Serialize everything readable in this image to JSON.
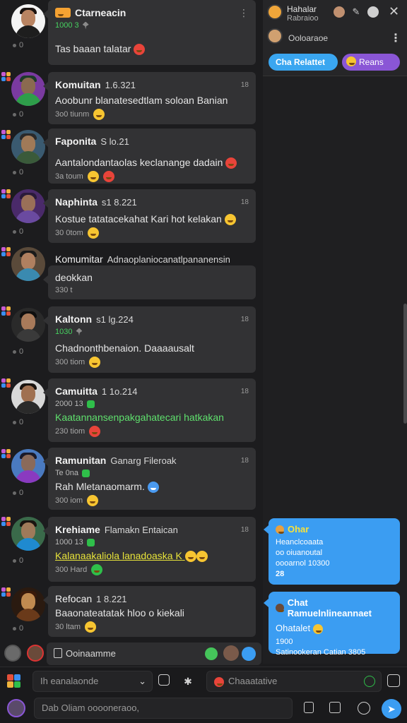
{
  "header": {
    "name": "Ctarneacin",
    "sub": "1000 3",
    "text": "Tas baaan talatar"
  },
  "messages": [
    {
      "name": "Komuitan",
      "time": "1.6.321",
      "right": "18",
      "text": "Aoobunr blanatesedtlam soloan Banian",
      "foot": "3o0 tiunm",
      "side": "0"
    },
    {
      "name": "Faponita",
      "time": "S lo.21",
      "right": "",
      "text": "Aantalondantaolas keclanange dadain",
      "foot": "3a toum",
      "side": "0"
    },
    {
      "name": "Naphinta",
      "time": "s1 8.221",
      "right": "18",
      "text": "Kostue tatatacekahat Kari hot kelakan",
      "foot": "30 0tom",
      "side": "0"
    },
    {
      "name": "Komumitar",
      "time": "Adnaoplaniocanatlpananensin",
      "right": "",
      "text": "deokkan",
      "foot": "330 t",
      "side": ""
    },
    {
      "name": "Kaltonn",
      "time": "s1 lg.224",
      "right": "18",
      "sub": "1030",
      "text": "Chadnonthbenaion. Daaaausalt",
      "foot": "300 tiom",
      "side": "0"
    },
    {
      "name": "Camuitta",
      "time": "1 1o.214",
      "right": "18",
      "sub": "2000 13",
      "text": "Kaatannansenpakgahatecari hatkakan",
      "foot": "230 tiom",
      "side": "0"
    },
    {
      "name": "Ramunitan",
      "time": "Ganarg Fileroak",
      "right": "18",
      "sub": "Te 0na",
      "text": "Rah Mletanaomarm.",
      "foot": "300 iom",
      "side": "0"
    },
    {
      "name": "Krehiame",
      "time": "Flamakn Entaican",
      "right": "18",
      "sub": "1000 13",
      "text": "Kalanaakaliola lanadoaska K",
      "foot": "300 Hard",
      "side": "0"
    },
    {
      "name": "Refocan",
      "time": "1 8.221",
      "right": "",
      "text": "Baaonateatatak hloo o kiekali",
      "foot": "30 ltam",
      "side": "0"
    }
  ],
  "quickbar": {
    "label": "Ooinaamme"
  },
  "right_panel": {
    "header_title": "Hahalar",
    "header_sub": "Rabraioo",
    "row2": "Ooloaraoe",
    "pill_blue": "Cha Relattet",
    "pill_purple": "Reans",
    "bubble1": {
      "title": "Ohar",
      "lines": [
        "Heanclcoaata",
        "oo oiuanoutal",
        "oooarnol 10300",
        "28"
      ]
    },
    "bubble2": {
      "title": "Chat Ramuelnlineannaet",
      "lines": [
        "Ohatalet",
        "1900",
        "Satinookeran Catian 3805"
      ]
    }
  },
  "composer": {
    "row1_left": "Ih eanalaonde",
    "row1_right": "Chaaatative",
    "row2": "Dab Oliam ooooneraoo,"
  },
  "colors": {
    "accent_blue": "#3b9df2",
    "accent_purple": "#8a56d6",
    "green": "#46d160",
    "bubble": "#323234"
  }
}
